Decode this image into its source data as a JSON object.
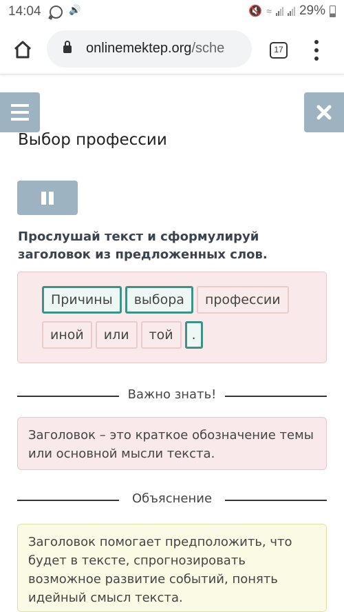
{
  "status_bar": {
    "time": "14:04",
    "battery": "29%",
    "icons": [
      "whatsapp-icon",
      "volume-icon",
      "mute-icon",
      "wifi-icon",
      "signal-icon",
      "signal-icon",
      "battery-icon"
    ]
  },
  "browser": {
    "url_host": "onlinemektep.org",
    "url_path": "/sche",
    "tab_count": "17"
  },
  "page": {
    "title": "Выбор профессии",
    "instruction": "Прослушай текст и сформулируй заголовок из предложенных слов.",
    "words_row1": [
      {
        "text": "Причины",
        "selected": true
      },
      {
        "text": "выбора",
        "selected": true
      },
      {
        "text": "профессии",
        "selected": false
      }
    ],
    "words_row2": [
      {
        "text": "иной",
        "selected": false
      },
      {
        "text": "или",
        "selected": false
      },
      {
        "text": "той",
        "selected": false
      },
      {
        "text": ".",
        "selected": true
      }
    ],
    "important_label": "Важно знать!",
    "important_text": "Заголовок – это краткое обозначение темы или основной мысли текста.",
    "explain_label": "Объяснение",
    "explain_text": "Заголовок помогает предположить, что будет в тексте, спрогнозировать возможное развитие событий, понять идейный смысл текста."
  },
  "colors": {
    "nav_button": "#9eb3c2",
    "selected_border": "#3e9187",
    "word_border": "#eec9c9",
    "pink_bg": "#f9e9ea",
    "yellow_bg": "#fbfae4"
  }
}
